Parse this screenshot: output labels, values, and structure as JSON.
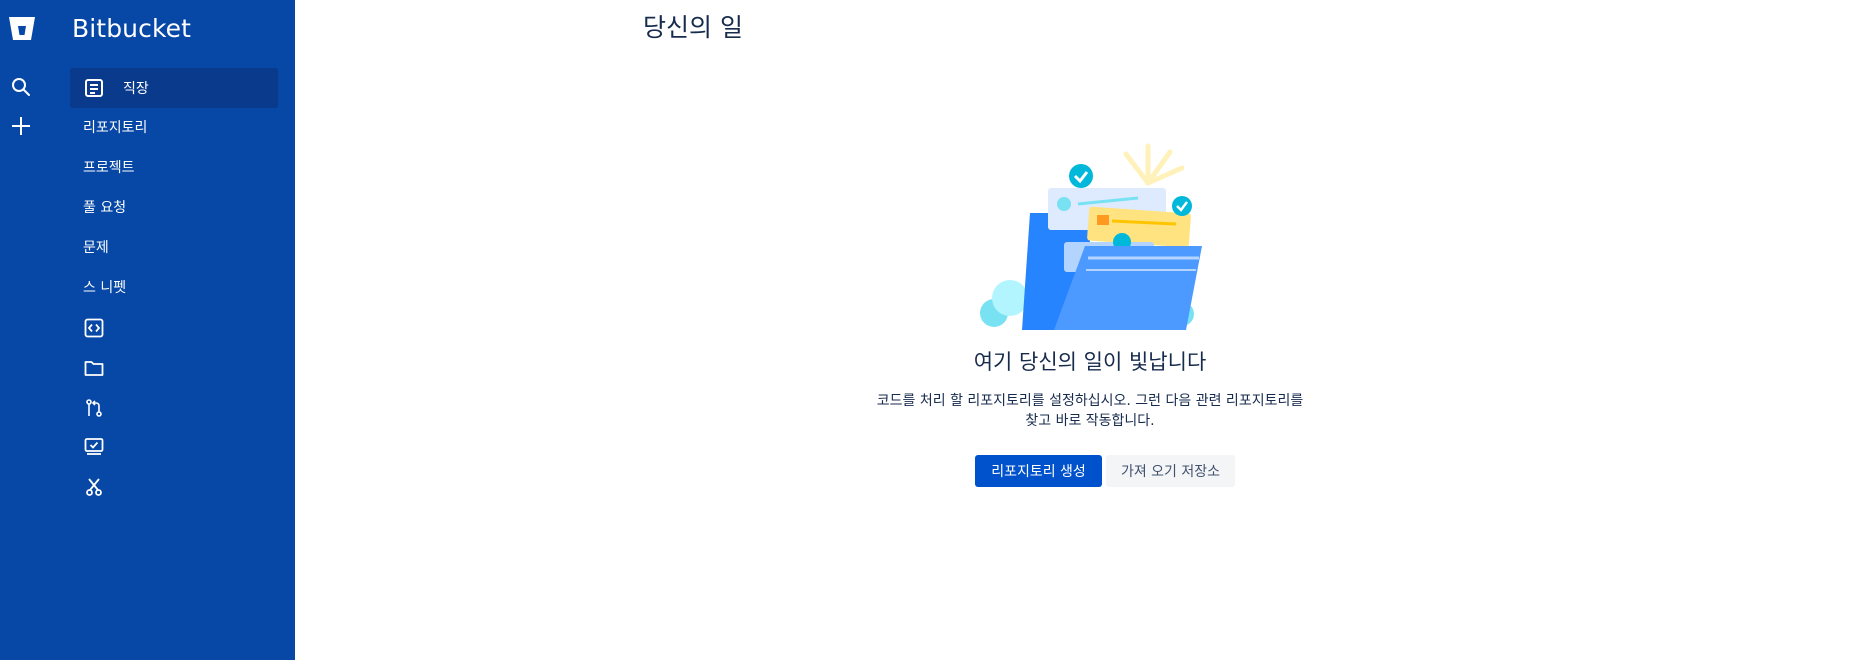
{
  "sidebar": {
    "product_name": "Bitbucket",
    "rail_icons": [
      "bitbucket-logo-icon",
      "search-icon",
      "plus-icon"
    ],
    "items": [
      {
        "label": "직장",
        "icon": "work-icon",
        "selected": true
      },
      {
        "label": "리포지토리"
      },
      {
        "label": "프로젝트"
      },
      {
        "label": "풀 요청"
      },
      {
        "label": "문제"
      },
      {
        "label": "스 니펫"
      }
    ],
    "icon_items": [
      "code-icon",
      "folder-icon",
      "pull-request-icon",
      "issues-icon",
      "snippets-icon"
    ]
  },
  "main": {
    "title": "당신의 일",
    "empty_state": {
      "heading": "여기 당신의 일이 빛납니다",
      "description_line1": "코드를 처리 할 리포지토리를 설정하십시오. 그런 다음 관련 리포지토리를",
      "description_line2": "찾고 바로 작동합니다.",
      "primary_button": "리포지토리 생성",
      "secondary_button": "가져 오기 저장소"
    }
  },
  "colors": {
    "sidebar_bg": "#0747a6",
    "sidebar_selected": "#0a3a8c",
    "primary": "#0052cc",
    "text": "#172b4d"
  }
}
